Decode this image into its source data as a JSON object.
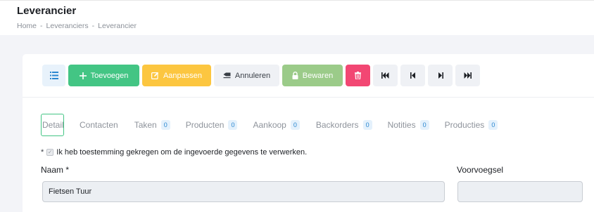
{
  "header": {
    "title": "Leverancier",
    "breadcrumb": [
      {
        "label": "Home"
      },
      {
        "label": "Leveranciers"
      },
      {
        "label": "Leverancier"
      }
    ],
    "separator": "-"
  },
  "toolbar": {
    "list_icon": "list-icon",
    "add_label": "Toevoegen",
    "edit_label": "Aanpassen",
    "cancel_label": "Annuleren",
    "save_label": "Bewaren",
    "delete_icon": "trash-icon",
    "nav_icons": [
      "first-icon",
      "previous-icon",
      "next-icon",
      "last-icon"
    ]
  },
  "tabs": [
    {
      "label": "Detail",
      "active": true
    },
    {
      "label": "Contacten"
    },
    {
      "label": "Taken",
      "count": "0"
    },
    {
      "label": "Producten",
      "count": "0"
    },
    {
      "label": "Aankoop",
      "count": "0"
    },
    {
      "label": "Backorders",
      "count": "0"
    },
    {
      "label": "Notities",
      "count": "0"
    },
    {
      "label": "Producties",
      "count": "0"
    }
  ],
  "form": {
    "consent_asterisk": "*",
    "consent_text": "Ik heb toestemming gekregen om de ingevoerde gegevens te verwerken.",
    "consent_checked": true,
    "name_label": "Naam *",
    "name_value": "Fietsen Tuur",
    "prefix_label": "Voorvoegsel",
    "prefix_value": ""
  },
  "colors": {
    "add": "#43c584",
    "edit": "#fcc640",
    "save": "#9bcb89",
    "delete": "#f24773",
    "active_tab_border": "#43c584",
    "badge_text": "#2a87d0"
  }
}
